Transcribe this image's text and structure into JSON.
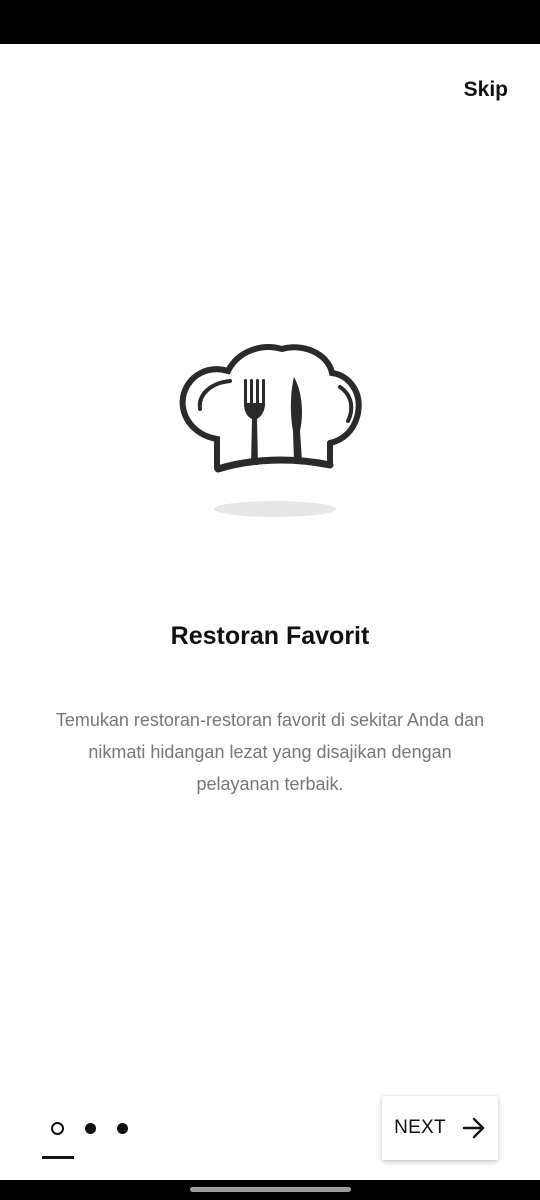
{
  "header": {
    "skip_label": "Skip"
  },
  "illustration": {
    "icon": "chef-hat-with-fork-and-knife"
  },
  "content": {
    "title": "Restoran Favorit",
    "description": "Temukan restoran-restoran favorit di sekitar Anda dan nikmati hidangan lezat yang disajikan dengan pelayanan terbaik."
  },
  "pager": {
    "total_pages": 3,
    "current_page": 1
  },
  "footer": {
    "next_label": "NEXT",
    "next_icon": "arrow-right-icon"
  },
  "colors": {
    "text": "#111111",
    "description": "#777777",
    "background": "#ffffff",
    "bars": "#000000"
  }
}
